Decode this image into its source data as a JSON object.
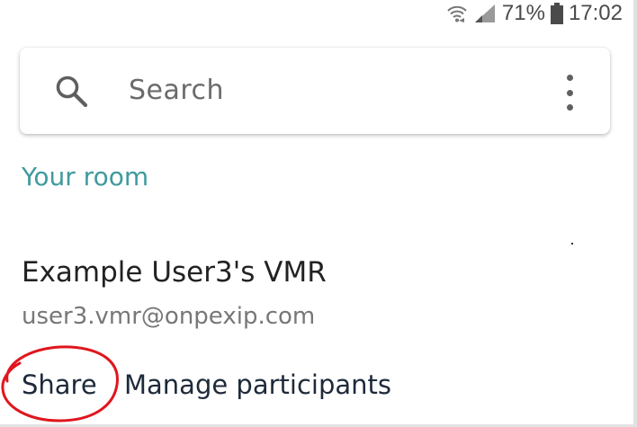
{
  "status_bar": {
    "battery_percent": "71%",
    "time": "17:02",
    "icons": [
      "wifi-icon",
      "signal-icon",
      "battery-icon"
    ]
  },
  "search": {
    "placeholder": "Search",
    "icons": [
      "search-icon",
      "more-vert-icon"
    ]
  },
  "section": {
    "heading": "Your room"
  },
  "room": {
    "name": "Example User3's VMR",
    "address": "user3.vmr@onpexip.com"
  },
  "actions": {
    "share_label": "Share",
    "manage_label": "Manage participants"
  },
  "colors": {
    "accent": "#3f9a9e",
    "annotation": "#e0161e",
    "text_primary": "#222222",
    "text_secondary": "#777777"
  }
}
